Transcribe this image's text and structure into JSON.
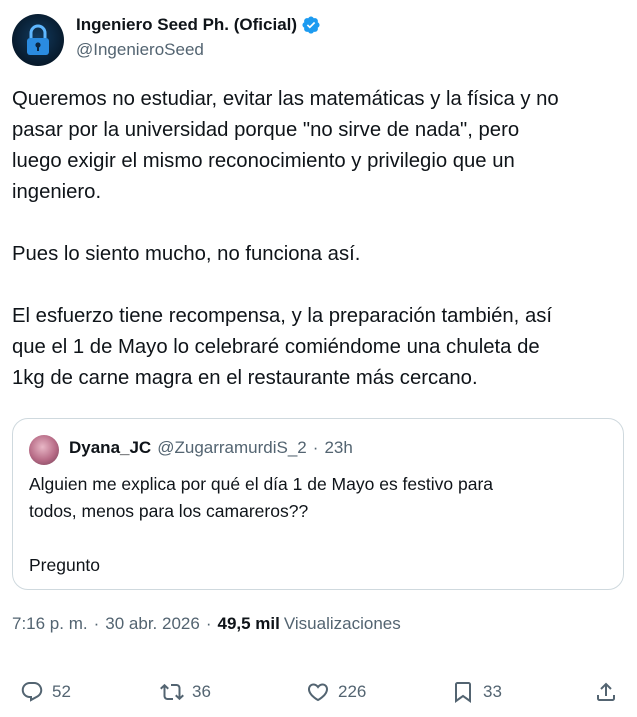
{
  "author": {
    "name": "Ingeniero Seed Ph. (Oficial)",
    "handle": "@IngenieroSeed"
  },
  "tweet": {
    "paragraphs": [
      [
        "Queremos no estudiar, evitar las matemáticas y la física y no",
        "pasar por la universidad porque \"no sirve de nada\", pero",
        "luego exigir el mismo reconocimiento y privilegio que un",
        "ingeniero."
      ],
      [
        "Pues lo siento mucho, no funciona así."
      ],
      [
        "El esfuerzo tiene recompensa, y la preparación también, así",
        "que el 1 de Mayo lo celebraré comiéndome una chuleta de",
        "1kg de carne magra en el restaurante más cercano."
      ]
    ]
  },
  "quote": {
    "name": "Dyana_JC",
    "handle": "@ZugarramurdiS_2",
    "dot": "·",
    "time": "23h",
    "lines": [
      "Alguien me explica por qué el día 1 de Mayo es festivo para",
      "todos, menos para los camareros??"
    ],
    "final_line": "Pregunto"
  },
  "meta": {
    "time": "7:16 p. m.",
    "dot": "·",
    "date": "30 abr. 2026",
    "views_count": "49,5 mil",
    "views_label": "Visualizaciones"
  },
  "actions": {
    "replies": "52",
    "reposts": "36",
    "likes": "226",
    "bookmarks": "33"
  },
  "colors": {
    "text": "#0f1419",
    "secondary": "#536471",
    "border": "#cfd9de",
    "verified": "#1d9bf0"
  },
  "icons": [
    "lock-avatar-icon",
    "verified-badge-icon",
    "reply-icon",
    "repost-icon",
    "like-icon",
    "bookmark-icon",
    "share-icon"
  ]
}
